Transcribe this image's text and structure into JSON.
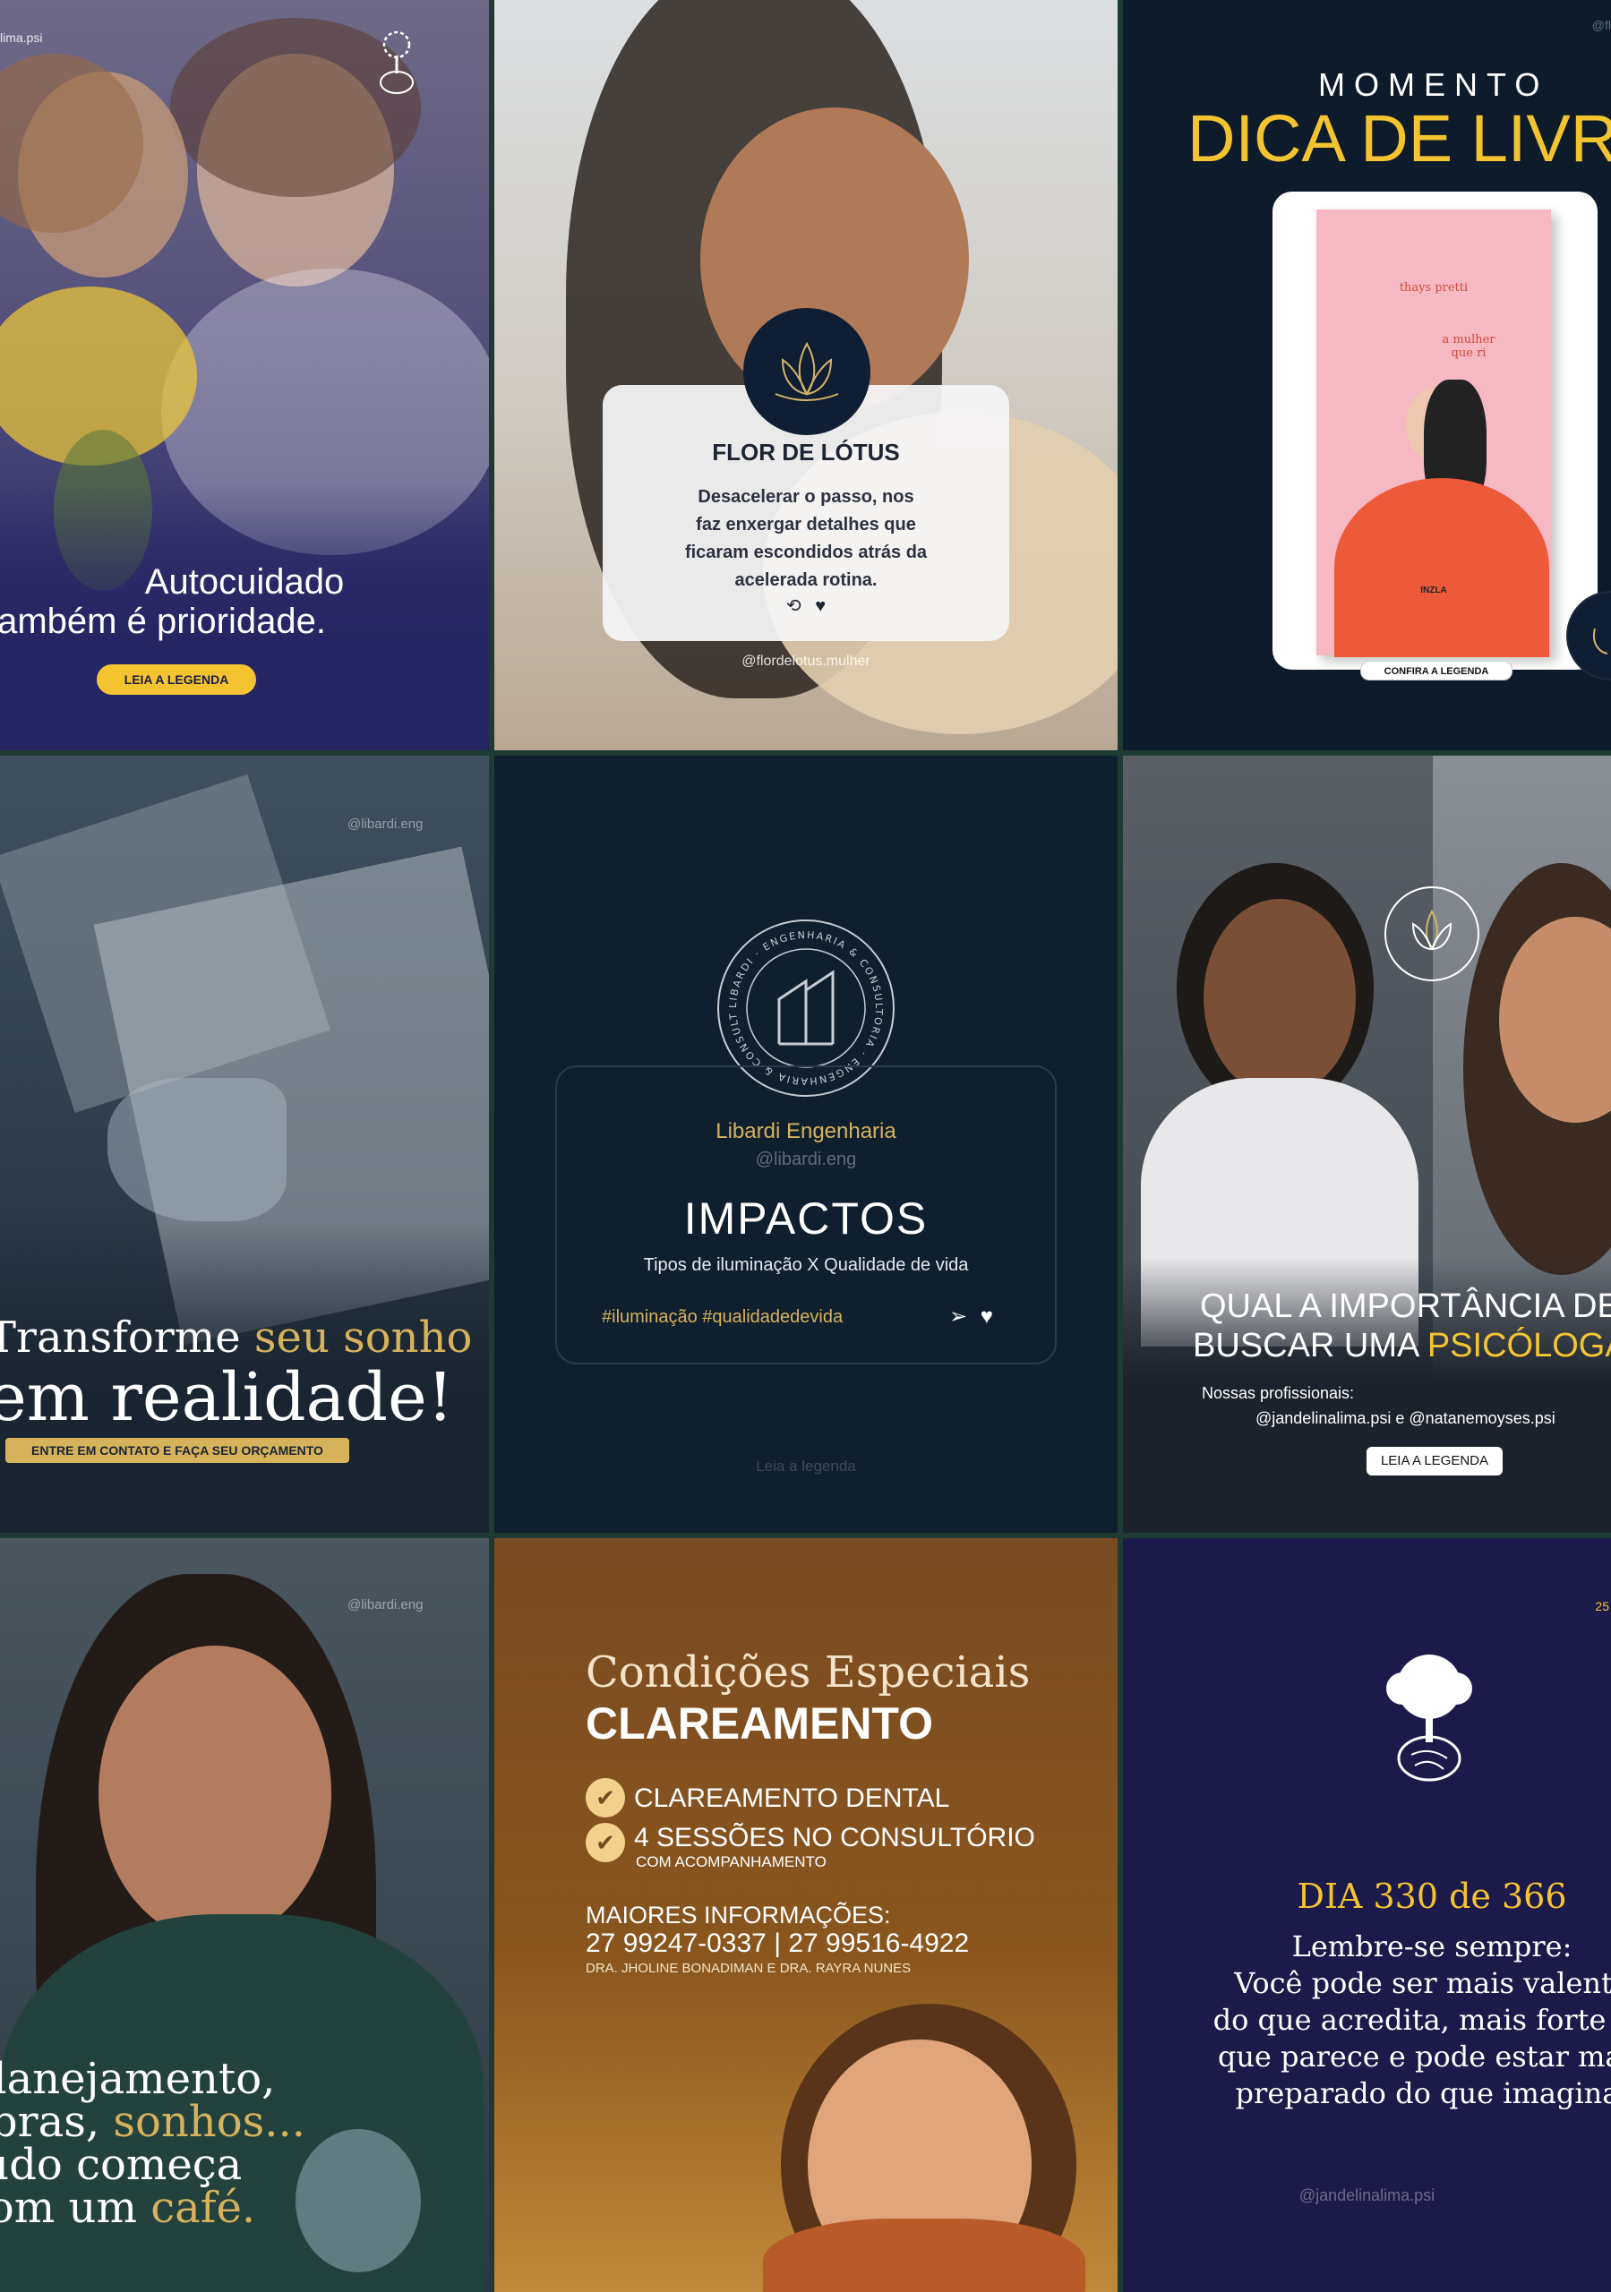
{
  "colors": {
    "gold": "#f4c430",
    "navy": "#0e1b2b",
    "navy_tile": "#0f1f2e",
    "amber": "#8a4f1e",
    "purple": "#1c1a4a",
    "divider": "#1f3a33"
  },
  "tiles": {
    "t1": {
      "handle": "lima.psi",
      "line1": "Autocuidado",
      "line2": "também é prioridade.",
      "cta": "LEIA A LEGENDA",
      "logo_icon": "tree-brain-icon"
    },
    "t2": {
      "title": "FLOR DE LÓTUS",
      "quote_l1": "Desacelerar o passo, nos",
      "quote_l2": "faz enxergar detalhes que",
      "quote_l3": "ficaram escondidos atrás da",
      "quote_l4": "acelerada rotina.",
      "repost_glyph": "⟲",
      "heart_glyph": "♥",
      "handle": "@flordelotus.mulher",
      "logo_icon": "lotus-icon"
    },
    "t3": {
      "kicker": "MOMENTO",
      "title": "DICA DE LIVRO",
      "book_author": "thays pretti",
      "book_title_l1": "a mulher",
      "book_title_l2": "que ri",
      "book_publisher": "INZLA",
      "cta": "CONFIRA A LEGENDA",
      "corner_handle": "@fl"
    },
    "t4": {
      "handle": "@libardi.eng",
      "line1_a": "Transforme ",
      "line1_b": "seu sonho",
      "line2": "em realidade!",
      "cta": "ENTRE EM CONTATO E FAÇA SEU ORÇAMENTO"
    },
    "t5": {
      "ring_text": "LIBARDI · ENGENHARIA & CONSULTORIA · ENGENHARIA & CONSULTORIA ·",
      "company": "Libardi Engenharia",
      "handle": "@libardi.eng",
      "title": "IMPACTOS",
      "subtitle": "Tipos de iluminação X Qualidade de vida",
      "hashtags": "#iluminação #qualidadedevida",
      "footer": "Leia a legenda",
      "send_glyph": "➢",
      "heart_glyph": "♥"
    },
    "t6": {
      "line1": "QUAL A IMPORTÂNCIA DE",
      "line2_a": "BUSCAR UMA ",
      "line2_b": "PSICÓLOGA?",
      "sub1": "Nossas profissionais:",
      "sub2": "@jandelinalima.psi e @natanemoyses.psi",
      "cta": "LEIA A LEGENDA"
    },
    "t7": {
      "handle": "@libardi.eng",
      "line1": "Planejamento,",
      "line2_a": "obras, ",
      "line2_b": "sonhos...",
      "line3": "tudo começa",
      "line4_a": "com um ",
      "line4_b": "café."
    },
    "t8": {
      "script_title": "Condições Especiais",
      "title": "CLAREAMENTO",
      "item1": "CLAREAMENTO DENTAL",
      "item2": "4 SESSÕES NO CONSULTÓRIO",
      "item2_sub": "COM ACOMPANHAMENTO",
      "info_title": "MAIORES INFORMAÇÕES:",
      "phones": "27 99247-0337 | 27 99516-4922",
      "doctors": "DRA. JHOLINE BONADIMAN E DRA. RAYRA NUNES",
      "check_glyph": "✔"
    },
    "t9": {
      "corner": "25",
      "day": "DIA 330 de 366",
      "l1": "Lembre-se sempre:",
      "l2": "Você pode ser mais valente",
      "l3": "do que acredita, mais forte do",
      "l4": "que parece e pode estar mais",
      "l5": "preparado do que imagina.",
      "handle": "@jandelinalima.psi",
      "logo_icon": "tree-brain-icon"
    }
  }
}
